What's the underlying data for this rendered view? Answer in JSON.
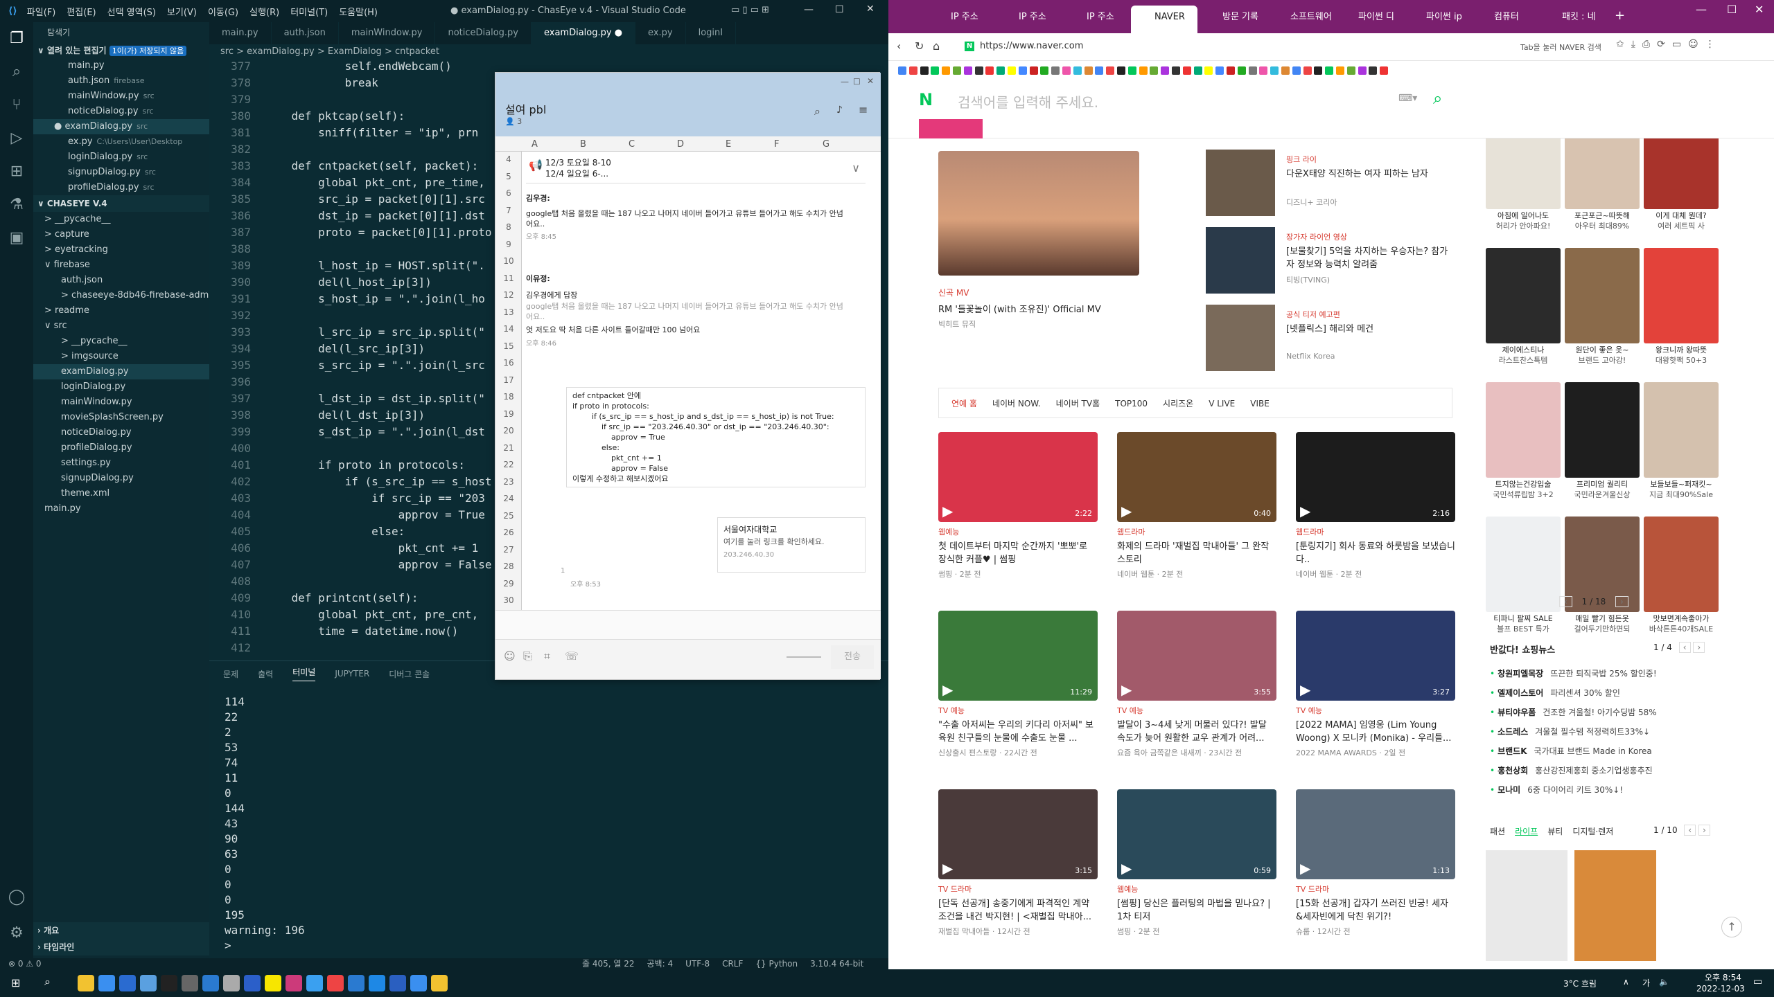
{
  "vscode": {
    "menu": [
      "파일(F)",
      "편집(E)",
      "선택 영역(S)",
      "보기(V)",
      "이동(G)",
      "실행(R)",
      "터미널(T)",
      "도움말(H)"
    ],
    "title": "● examDialog.py - ChasEye v.4 - Visual Studio Code",
    "explorer_header": "탐색기",
    "open_editors_label": "열려 있는 편집기",
    "open_editors_badge": "1이(가) 저장되지 않음",
    "open_editors": [
      {
        "name": "main.py",
        "desc": ""
      },
      {
        "name": "auth.json",
        "desc": "firebase"
      },
      {
        "name": "mainWindow.py",
        "desc": "src"
      },
      {
        "name": "noticeDialog.py",
        "desc": "src"
      },
      {
        "name": "● examDialog.py",
        "desc": "src"
      },
      {
        "name": "ex.py",
        "desc": "C:\\Users\\User\\Desktop"
      },
      {
        "name": "loginDialog.py",
        "desc": "src"
      },
      {
        "name": "signupDialog.py",
        "desc": "src"
      },
      {
        "name": "profileDialog.py",
        "desc": "src"
      }
    ],
    "project_label": "CHASEYE V.4",
    "tree": [
      "> __pycache__",
      "> capture",
      "> eyetracking",
      "∨ firebase",
      "auth.json",
      "> chaseeye-8db46-firebase-adminsd...",
      "> readme",
      "∨ src",
      "> __pycache__",
      "> imgsource",
      "examDialog.py",
      "loginDialog.py",
      "mainWindow.py",
      "movieSplashScreen.py",
      "noticeDialog.py",
      "profileDialog.py",
      "settings.py",
      "signupDialog.py",
      "theme.xml",
      "main.py"
    ],
    "outline_label": "개요",
    "timeline_label": "타임라인",
    "tabs": [
      "main.py",
      "auth.json",
      "mainWindow.py",
      "noticeDialog.py",
      "examDialog.py ●",
      "ex.py",
      "loginI"
    ],
    "breadcrumb": "src > examDialog.py > ExamDialog > cntpacket",
    "code_lines": [
      [
        "377",
        "            self.endWebcam()"
      ],
      [
        "378",
        "            break"
      ],
      [
        "379",
        ""
      ],
      [
        "380",
        "    def pktcap(self):"
      ],
      [
        "381",
        "        sniff(filter = \"ip\", prn"
      ],
      [
        "382",
        ""
      ],
      [
        "383",
        "    def cntpacket(self, packet):"
      ],
      [
        "384",
        "        global pkt_cnt, pre_time,"
      ],
      [
        "385",
        "        src_ip = packet[0][1].src"
      ],
      [
        "386",
        "        dst_ip = packet[0][1].dst"
      ],
      [
        "387",
        "        proto = packet[0][1].proto"
      ],
      [
        "388",
        ""
      ],
      [
        "389",
        "        l_host_ip = HOST.split(\"."
      ],
      [
        "390",
        "        del(l_host_ip[3])"
      ],
      [
        "391",
        "        s_host_ip = \".\".join(l_ho"
      ],
      [
        "392",
        ""
      ],
      [
        "393",
        "        l_src_ip = src_ip.split(\""
      ],
      [
        "394",
        "        del(l_src_ip[3])"
      ],
      [
        "395",
        "        s_src_ip = \".\".join(l_src"
      ],
      [
        "396",
        ""
      ],
      [
        "397",
        "        l_dst_ip = dst_ip.split(\""
      ],
      [
        "398",
        "        del(l_dst_ip[3])"
      ],
      [
        "399",
        "        s_dst_ip = \".\".join(l_dst"
      ],
      [
        "400",
        ""
      ],
      [
        "401",
        "        if proto in protocols:"
      ],
      [
        "402",
        "            if (s_src_ip == s_host"
      ],
      [
        "403",
        "                if src_ip == \"203"
      ],
      [
        "404",
        "                    approv = True"
      ],
      [
        "405",
        "                else:"
      ],
      [
        "406",
        "                    pkt_cnt += 1"
      ],
      [
        "407",
        "                    approv = False"
      ],
      [
        "408",
        ""
      ],
      [
        "409",
        "    def printcnt(self):"
      ],
      [
        "410",
        "        global pkt_cnt, pre_cnt,"
      ],
      [
        "411",
        "        time = datetime.now()"
      ],
      [
        "412",
        ""
      ]
    ],
    "panel_tabs": [
      "문제",
      "출력",
      "터미널",
      "JUPYTER",
      "디버그 콘솔"
    ],
    "terminal_lines": [
      "114",
      "22",
      "2",
      "53",
      "74",
      "11",
      "0",
      "144",
      "43",
      "90",
      "63",
      "0",
      "0",
      "0",
      "195",
      "warning: 196",
      ">"
    ],
    "status_left": "⊗ 0  ⚠ 0",
    "status_right": [
      "줄 405, 열 22",
      "공백: 4",
      "UTF-8",
      "CRLF",
      "{} Python",
      "3.10.4 64-bit"
    ]
  },
  "kakao": {
    "title": "설여 pbl",
    "members": "3",
    "columns": [
      "A",
      "B",
      "C",
      "D",
      "E",
      "F",
      "G"
    ],
    "rows": [
      "4",
      "5",
      "6",
      "7",
      "8",
      "9",
      "10",
      "11",
      "12",
      "13",
      "14",
      "15",
      "16",
      "17",
      "18",
      "19",
      "20",
      "21",
      "22",
      "23",
      "24",
      "25",
      "26",
      "27",
      "28",
      "29",
      "30"
    ],
    "notice": "12/3 토요일 8-10\n12/4 일요일 6-...",
    "sender1": "김우경:",
    "msg1": "google탭 처음 올렸을 때는 187 나오고 나머지 네이버 들어가고 유튜브 들어가고 해도 수치가 안넘어요..",
    "time1": "오후 8:45",
    "sender2": "이유정:",
    "reply_to": "김우경에게 답장",
    "reply_quote": "google탭 처음 올렸을 때는 187 나오고 나머지 네이버 들어가고 유튜브 들어가고 해도 수치가 안넘어요..",
    "msg2": "엇 저도요 딱 처음 다른 사이트 들어갈때만 100 넘어요",
    "time2": "오후 8:46",
    "code_msg": [
      "def cntpacket 안에",
      "if proto in protocols:",
      "        if (s_src_ip == s_host_ip and s_dst_ip == s_host_ip) is not True:",
      "            if src_ip == \"203.246.40.30\" or dst_ip == \"203.246.40.30\":",
      "                approv = True",
      "            else:",
      "                pkt_cnt += 1",
      "                approv = False",
      "이렇게 수정하고 해보시겠어요"
    ],
    "link_title": "서울여자대학교",
    "link_desc": "여기를 눌러 링크를 확인하세요.",
    "link_url": "203.246.40.30",
    "unread": "1",
    "time3": "오후 8:53",
    "send": "전송"
  },
  "browser": {
    "tabs": [
      "IP 주소",
      "IP 주소",
      "IP 주소",
      "NAVER",
      "방문 기록",
      "소프트웨어",
      "파이썬 디",
      "파이썬 ip",
      "컴퓨터",
      "패킷 : 네"
    ],
    "url": "https://www.naver.com",
    "search_hint": "Tab을 눌러 NAVER 검색",
    "search_placeholder": "검색어를 입력해 주세요.",
    "main_video": {
      "cat": "신곡 MV",
      "title": "RM '들꽃놀이 (with 조유진)' Official MV",
      "src": "빅히트 뮤직"
    },
    "side_news": [
      {
        "cat": "핑크 라이",
        "title": "다운X태양 직진하는 여자 피하는 남자",
        "src": "디즈니+ 코리아"
      },
      {
        "cat": "장가자 라이언 영상",
        "title": "[보물찾기] 5억을 차지하는 우승자는? 참가자 정보와 능력치 알려줌",
        "src": "티빙(TVING)"
      },
      {
        "cat": "공식 티저 예고편",
        "title": "[넷플릭스] 해리와 메건",
        "src": "Netflix Korea"
      }
    ],
    "subtabs": [
      "연예 홈",
      "네이버 NOW.",
      "네이버 TV홈",
      "TOP100",
      "시리즈온",
      "V LIVE",
      "VIBE"
    ],
    "videos": [
      {
        "cat": "웹예능",
        "title": "첫 데이트부터 마지막 순간까지 '뽀뽀'로 장식한 커플♥ | 썸핑",
        "src": "썸핑 · 2분 전",
        "dur": "2:22",
        "color": "#d9344a"
      },
      {
        "cat": "웹드라마",
        "title": "화제의 드라마 '재벌집 막내아들' 그 완작 스토리",
        "src": "네이버 웹툰 · 2분 전",
        "dur": "0:40",
        "color": "#6b4a2a"
      },
      {
        "cat": "웹드라마",
        "title": "[툰링지기] 회사 동료와 하룻밤을 보냈습니다..",
        "src": "네이버 웹툰 · 2분 전",
        "dur": "2:16",
        "color": "#1c1c1c"
      },
      {
        "cat": "TV 예능",
        "title": "\"수출 아저씨는 우리의 키다리 아저씨\" 보육원 친구들의 눈물에 수출도 눈물 ...",
        "src": "신상출시 편스토랑 · 22시간 전",
        "dur": "11:29",
        "color": "#3a7a3a"
      },
      {
        "cat": "TV 예능",
        "title": "발달이 3~4세 낮게 머물러 있다?! 발달 속도가 늦어 원활한 교우 관계가 어려...",
        "src": "요즘 육아 금쪽같은 내새끼 · 23시간 전",
        "dur": "3:55",
        "color": "#a25a6a"
      },
      {
        "cat": "TV 예능",
        "title": "[2022 MAMA] 임영웅 (Lim Young Woong) X 모니카 (Monika) - 우리들...",
        "src": "2022 MAMA AWARDS · 2일 전",
        "dur": "3:27",
        "color": "#2a3a6a"
      },
      {
        "cat": "TV 드라마",
        "title": "[단독 선공개] 송중기에게 파격적인 계약 조건을 내건 박지현! | <재벌집 막내아...",
        "src": "재벌집 막내아들 · 12시간 전",
        "dur": "3:15",
        "color": "#4a3a3a"
      },
      {
        "cat": "웹예능",
        "title": "[썸핑] 당신은 플러팅의 마법을 믿나요? | 1차 티저",
        "src": "썸핑 · 2분 전",
        "dur": "0:59",
        "color": "#2a4a5a"
      },
      {
        "cat": "TV 드라마",
        "title": "[15화 선공개] 갑자기 쓰러진 빈궁! 세자&세자빈에게 닥친 위기?!",
        "src": "슈룹 · 12시간 전",
        "dur": "1:13",
        "color": "#5a6a7a"
      }
    ],
    "products": [
      {
        "t1": "아침에 일어나도",
        "t2": "허리가 안아파요!",
        "c": "#e7e2d8"
      },
      {
        "t1": "포근포근~따뜻해",
        "t2": "아우터 최대89%",
        "c": "#d8c3b0"
      },
      {
        "t1": "이게 대체 뭔데?",
        "t2": "여러 세트픽 사",
        "c": "#a8332b"
      },
      {
        "t1": "제이에스티나",
        "t2": "라스트찬스특템",
        "c": "#2b2b2b"
      },
      {
        "t1": "원단이 좋은 옷~",
        "t2": "브랜드 고아강!",
        "c": "#8a6a4a"
      },
      {
        "t1": "왕크니까 왕따뜻",
        "t2": "대왕핫팩 50+3",
        "c": "#e3423a"
      },
      {
        "t1": "트지않는건강입술",
        "t2": "국민석류립밤 3+2",
        "c": "#e8bfc0"
      },
      {
        "t1": "프리미엄 퀄리티",
        "t2": "국민라운겨울신상",
        "c": "#1e1e1e"
      },
      {
        "t1": "보들보들~퍼재킷~",
        "t2": "지금 최대90%Sale",
        "c": "#d4c1ae"
      },
      {
        "t1": "티파니 팔찌 SALE",
        "t2": "블프 BEST 특가",
        "c": "#eef0f2"
      },
      {
        "t1": "매일 빨기 힘든옷",
        "t2": "걸어두기만하면되",
        "c": "#7a5a4a"
      },
      {
        "t1": "맛보면계속좋아가",
        "t2": "바삭튼튼40개SALE",
        "c": "#b8543a"
      }
    ],
    "prod_page": "1 / 18",
    "shop_news_title": "반값다! 쇼핑뉴스",
    "shop_news_page": "1 / 4",
    "shop_news": [
      {
        "b": "창원피엘목장",
        "d": "뜨끈한 퇴직국밥 25% 할인중!"
      },
      {
        "b": "엘제이스토어",
        "d": "파리센셔 30% 할인"
      },
      {
        "b": "뷰티야우폼",
        "d": "건조한 겨울철! 아기수딩밤 58%"
      },
      {
        "b": "소드레스",
        "d": "겨울철 필수템 적정력히트33%↓"
      },
      {
        "b": "브랜드K",
        "d": "국가대표 브랜드 Made in Korea"
      },
      {
        "b": "홍천상회",
        "d": "홍산강진제홍회 중소기업생홍추진"
      },
      {
        "b": "모나미",
        "d": "6중 다이어리 키트 30%↓!"
      }
    ],
    "bottom_tabs": [
      "패션",
      "라이프",
      "뷰티",
      "디지털·렌저"
    ],
    "bottom_page": "1 / 10"
  },
  "taskbar": {
    "weather": "3°C 흐림",
    "ime": "가",
    "time": "오후 8:54",
    "date": "2022-12-03"
  }
}
